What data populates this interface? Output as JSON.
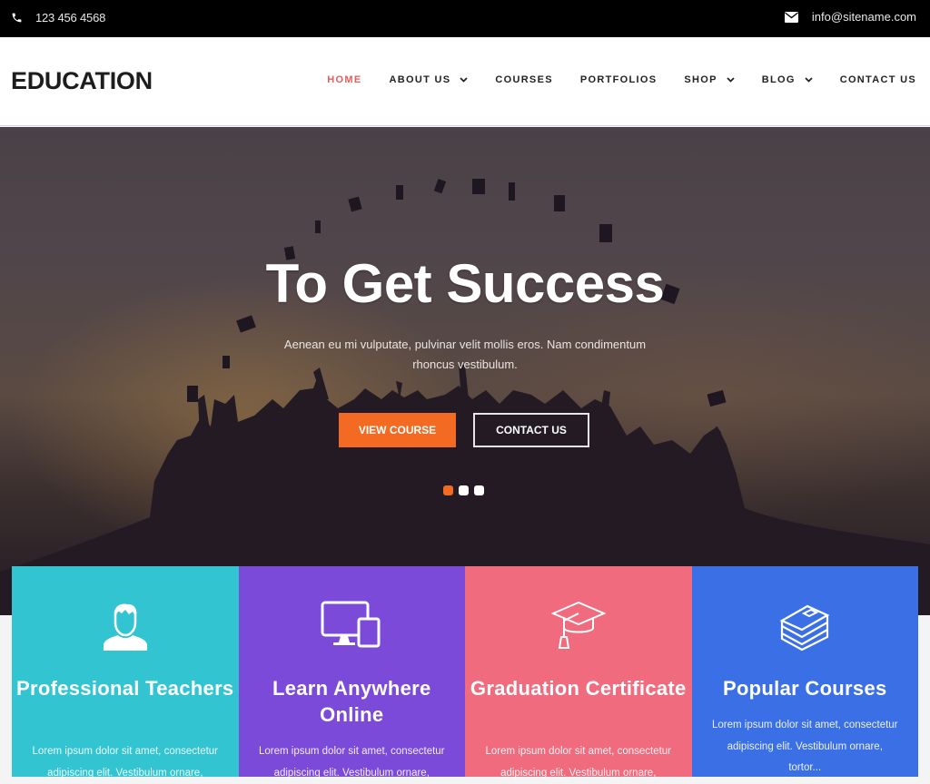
{
  "topbar": {
    "phone": "123 456 4568",
    "email": "info@sitename.com",
    "phone_icon": "phone-icon",
    "email_icon": "envelope-icon"
  },
  "header": {
    "logo": "EDUCATION",
    "nav": [
      {
        "label": "HOME",
        "active": true,
        "has_dropdown": false
      },
      {
        "label": "ABOUT US",
        "active": false,
        "has_dropdown": true
      },
      {
        "label": "COURSES",
        "active": false,
        "has_dropdown": false
      },
      {
        "label": "PORTFOLIOS",
        "active": false,
        "has_dropdown": false
      },
      {
        "label": "SHOP",
        "active": false,
        "has_dropdown": true
      },
      {
        "label": "BLOG",
        "active": false,
        "has_dropdown": true
      },
      {
        "label": "CONTACT US",
        "active": false,
        "has_dropdown": false
      }
    ]
  },
  "hero": {
    "title": "To Get Success",
    "subtitle": "Aenean eu mi vulputate, pulvinar velit mollis eros. Nam condimentum rhoncus vestibulum.",
    "primary_button": "VIEW COURSE",
    "secondary_button": "CONTACT US",
    "slides": 3,
    "active_slide": 1
  },
  "features": [
    {
      "title": "Professional Teachers",
      "description": "Lorem ipsum dolor sit amet, consectetur adipiscing elit. Vestibulum ornare,",
      "icon": "teacher-icon",
      "color": "#33c4d2"
    },
    {
      "title": "Learn Anywhere Online",
      "description": "Lorem ipsum dolor sit amet, consectetur adipiscing elit. Vestibulum ornare,",
      "icon": "devices-icon",
      "color": "#7b4ad8"
    },
    {
      "title": "Graduation Certificate",
      "description": "Lorem ipsum dolor sit amet, consectetur adipiscing elit. Vestibulum ornare,",
      "icon": "graduation-cap-icon",
      "color": "#f06b7e"
    },
    {
      "title": "Popular Courses",
      "description": "Lorem ipsum dolor sit amet, consectetur adipiscing elit. Vestibulum ornare, tortor...",
      "icon": "books-icon",
      "color": "#3a6fe6"
    }
  ],
  "colors": {
    "accent": "#f36b22",
    "nav_active": "#e35d5b",
    "topbar": "#000000"
  }
}
